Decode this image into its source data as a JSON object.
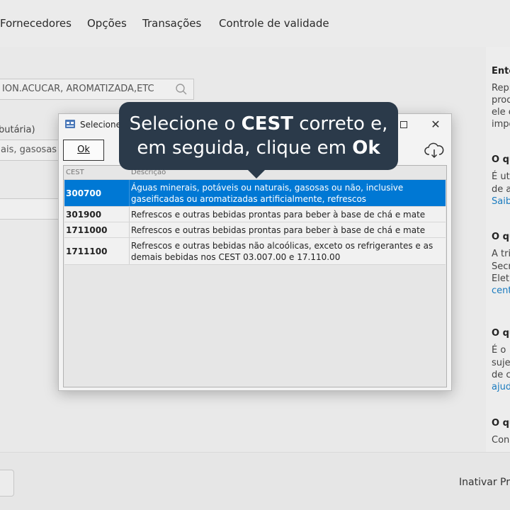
{
  "menu": {
    "items": [
      "Fornecedores",
      "Opções",
      "Transações",
      "Controle de validade"
    ]
  },
  "background": {
    "search_text": "ION.ACUCAR, AROMATIZADA,ETC",
    "field_label": "butária)",
    "field_value": "ais, gasosas o"
  },
  "right_panel": {
    "sections": [
      {
        "title": "Ente",
        "lines": [
          "Repr",
          "prod",
          "ele e",
          "impo"
        ]
      },
      {
        "title": "O qu",
        "lines": [
          "É ut",
          "de a"
        ],
        "link": "Saib"
      },
      {
        "title": "O qu",
        "lines": [
          "A tri",
          "Secr",
          "Eletr"
        ],
        "link": "cent"
      },
      {
        "title": "O qu",
        "lines": [
          "É o",
          "suje",
          "de c"
        ],
        "link": "ajud"
      },
      {
        "title": "O qu",
        "lines": [
          "Con"
        ]
      }
    ]
  },
  "footer": {
    "action_label": "Inativar Pro"
  },
  "dialog": {
    "title": "Selecione o",
    "ok_label": "Ok",
    "columns": {
      "code": "CEST",
      "description": "Descrição"
    },
    "rows": [
      {
        "code": "300700",
        "description": "Águas minerais, potáveis ou naturais, gasosas ou não, inclusive gaseificadas ou aromatizadas artificialmente, refrescos",
        "selected": true
      },
      {
        "code": "301900",
        "description": "Refrescos e outras bebidas prontas para beber à base de chá e mate",
        "selected": false
      },
      {
        "code": "1711000",
        "description": "Refrescos e outras bebidas prontas para beber à base de chá e mate",
        "selected": false
      },
      {
        "code": "1711100",
        "description": "Refrescos e outras bebidas não alcoólicas, exceto os refrigerantes e as demais bebidas nos CEST 03.007.00 e 17.110.00",
        "selected": false
      }
    ]
  },
  "tooltip": {
    "line1_pre": "Selecione o ",
    "line1_bold": "CEST",
    "line1_post": " correto e,",
    "line2_pre": "em seguida, clique em ",
    "line2_bold": "Ok"
  },
  "colors": {
    "selection": "#0078d4",
    "tooltip_bg": "#2b3a4a",
    "link": "#1a7bbf"
  },
  "icons": {
    "search": "search-icon",
    "app": "app-icon",
    "maximize": "maximize-icon",
    "close": "close-icon",
    "cloud": "cloud-download-icon"
  }
}
